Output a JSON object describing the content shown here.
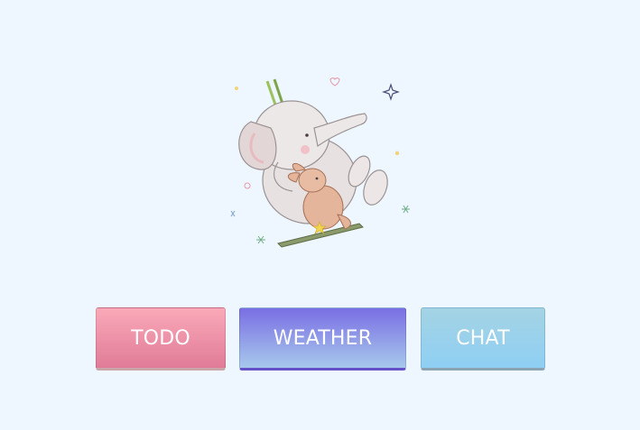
{
  "illustration": {
    "icon": "elephant-and-bunny-on-swing"
  },
  "buttons": {
    "todo_label": "TODO",
    "weather_label": "WEATHER",
    "chat_label": "CHAT"
  },
  "colors": {
    "background": "#eef6ff",
    "todo": "#f39cb2",
    "weather": "#7b71e3",
    "chat": "#97d1ec"
  }
}
